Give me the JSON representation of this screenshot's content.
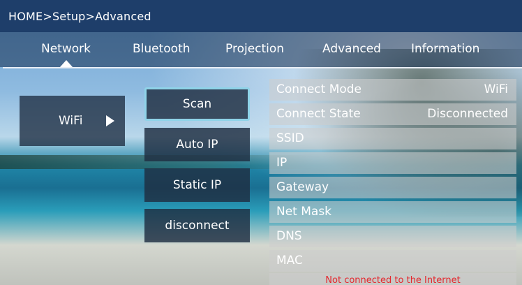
{
  "breadcrumb": "HOME>Setup>Advanced",
  "tabs": [
    {
      "label": "Network"
    },
    {
      "label": "Bluetooth"
    },
    {
      "label": "Projection"
    },
    {
      "label": "Advanced"
    },
    {
      "label": "Information"
    }
  ],
  "selected_tab": "Network",
  "sidebar": {
    "wifi_label": "WiFi"
  },
  "buttons": {
    "scan": "Scan",
    "auto_ip": "Auto IP",
    "static_ip": "Static IP",
    "disconnect": "disconnect"
  },
  "info": [
    {
      "label": "Connect Mode",
      "value": "WiFi"
    },
    {
      "label": "Connect State",
      "value": "Disconnected"
    },
    {
      "label": "SSID",
      "value": ""
    },
    {
      "label": "IP",
      "value": ""
    },
    {
      "label": "Gateway",
      "value": ""
    },
    {
      "label": "Net Mask",
      "value": ""
    },
    {
      "label": "DNS",
      "value": ""
    },
    {
      "label": "MAC",
      "value": ""
    }
  ],
  "status_message": "Not connected to the Internet",
  "colors": {
    "header_bg": "#1e3e6a",
    "focus_border": "#8fd3e8",
    "status_text": "#e4272d"
  }
}
